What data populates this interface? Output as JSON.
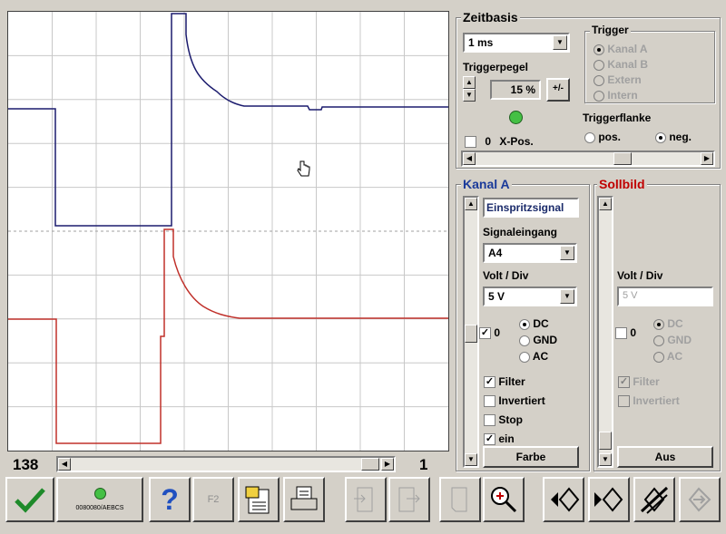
{
  "scope": {
    "left_counter": "138",
    "right_counter": "1"
  },
  "zeitbasis": {
    "title": "Zeitbasis",
    "value": "1 ms",
    "triggerpegel_label": "Triggerpegel",
    "triggerpegel_value": "15 %",
    "plus_minus": "+/-",
    "xpos_value": "0",
    "xpos_label": "X-Pos.",
    "trigger_title": "Trigger",
    "trigger_options": [
      "Kanal A",
      "Kanal B",
      "Extern",
      "Intern"
    ],
    "triggerflanke_label": "Triggerflanke",
    "flank_pos": "pos.",
    "flank_neg": "neg."
  },
  "kanal_a": {
    "title": "Kanal A",
    "signal_name": "Einspritzsignal",
    "signaleingang_label": "Signaleingang",
    "signaleingang_value": "A4",
    "volt_div_label": "Volt / Div",
    "volt_div_value": "5 V",
    "zero": "0",
    "coupling": [
      "DC",
      "GND",
      "AC"
    ],
    "filter": "Filter",
    "invertiert": "Invertiert",
    "stop": "Stop",
    "ein": "ein",
    "farbe": "Farbe"
  },
  "sollbild": {
    "title": "Sollbild",
    "volt_div_label": "Volt / Div",
    "volt_div_value": "5 V",
    "zero": "0",
    "coupling": [
      "DC",
      "GND",
      "AC"
    ],
    "filter": "Filter",
    "invertiert": "Invertiert",
    "aus": "Aus"
  },
  "toolbar": {
    "device_code": "0080080/AEBCS",
    "f2": "F2"
  },
  "colors": {
    "channel_a": "#1c1c6e",
    "sollbild": "#c0302a",
    "title_blue": "#1a3a9a",
    "title_red": "#c00000"
  }
}
